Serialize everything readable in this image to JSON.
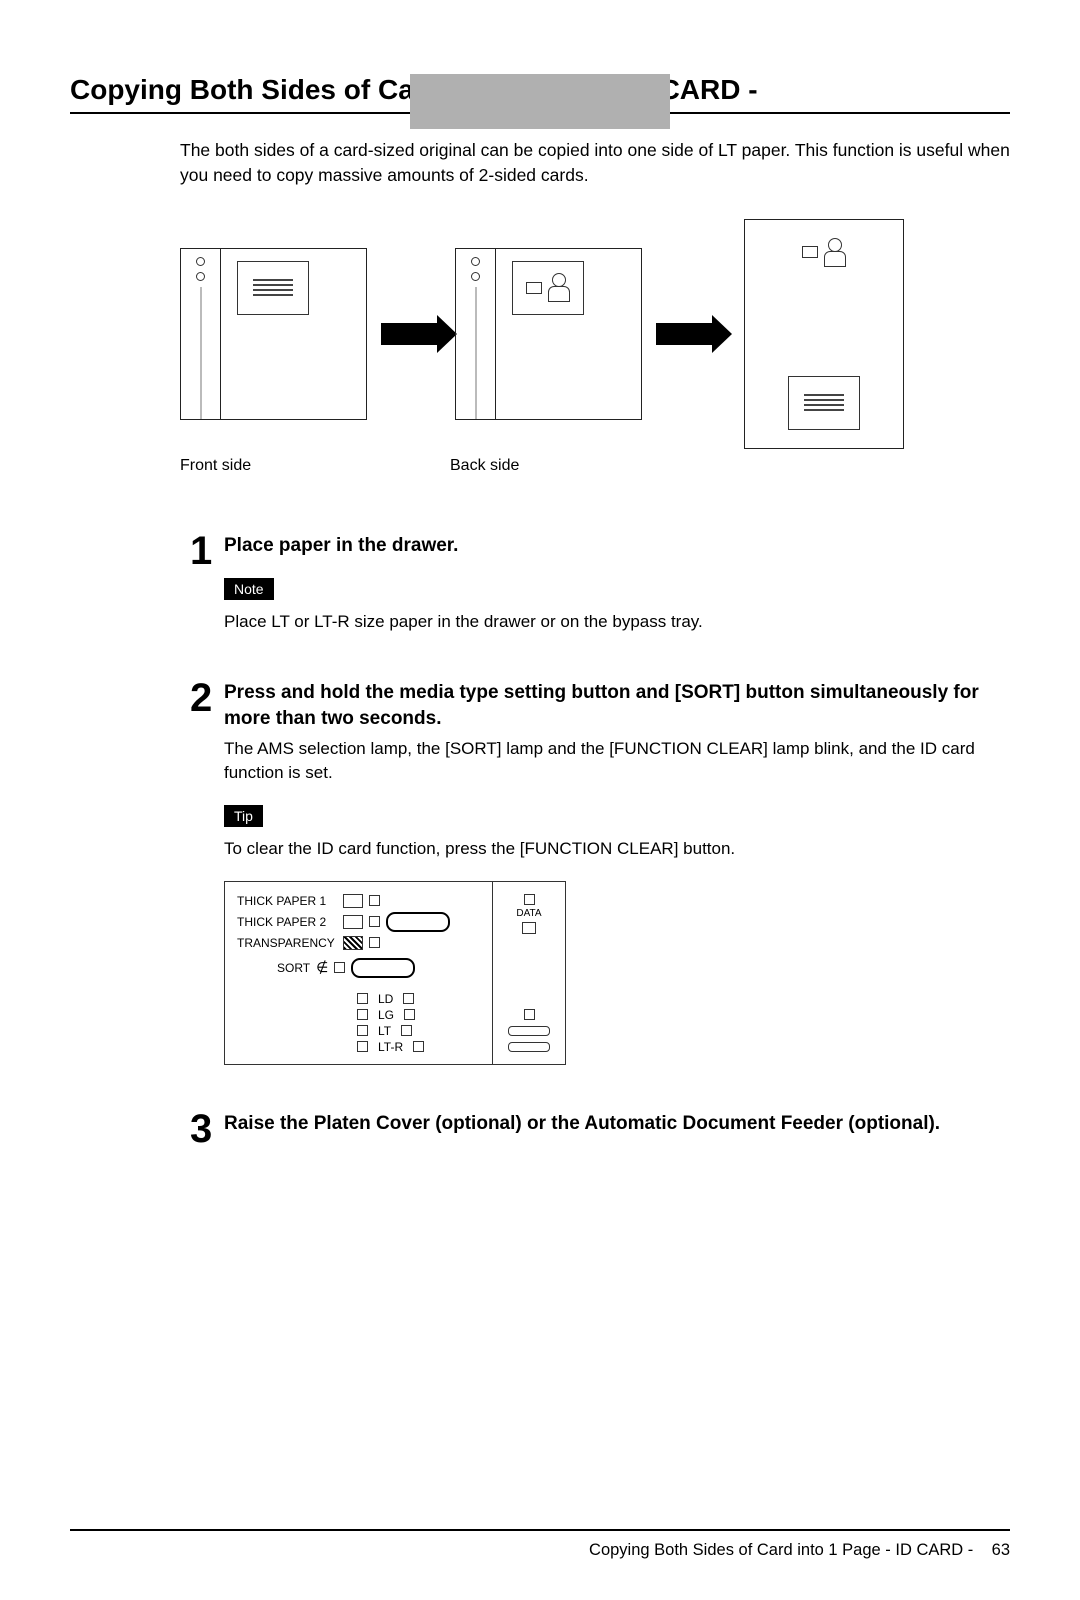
{
  "heading": "Copying Both Sides of Card into 1 Page - ID CARD -",
  "intro": "The both sides of a card-sized original can be copied into one side of LT paper. This function is useful when you need to copy massive amounts of 2-sided cards.",
  "captions": {
    "front": "Front side",
    "back": "Back side"
  },
  "steps": [
    {
      "num": "1",
      "title": "Place paper in the drawer.",
      "note_label": "Note",
      "note_text": "Place LT or LT-R size paper in the drawer or on the bypass tray."
    },
    {
      "num": "2",
      "title": "Press and hold the media type setting button and [SORT] button simultaneously for more than two seconds.",
      "body": "The AMS selection lamp, the [SORT] lamp and the [FUNCTION CLEAR] lamp blink, and the ID card function is set.",
      "tip_label": "Tip",
      "tip_text": "To clear the ID card function, press the [FUNCTION CLEAR] button."
    },
    {
      "num": "3",
      "title": "Raise the Platen Cover (optional) or the Automatic Document Feeder (optional)."
    }
  ],
  "panel": {
    "rows": [
      "THICK PAPER 1",
      "THICK PAPER 2",
      "TRANSPARENCY",
      "SORT"
    ],
    "sizes": [
      "LD",
      "LG",
      "LT",
      "LT-R"
    ],
    "data": "DATA"
  },
  "footer": {
    "text": "Copying Both Sides of Card into 1 Page - ID CARD -",
    "page": "63"
  }
}
